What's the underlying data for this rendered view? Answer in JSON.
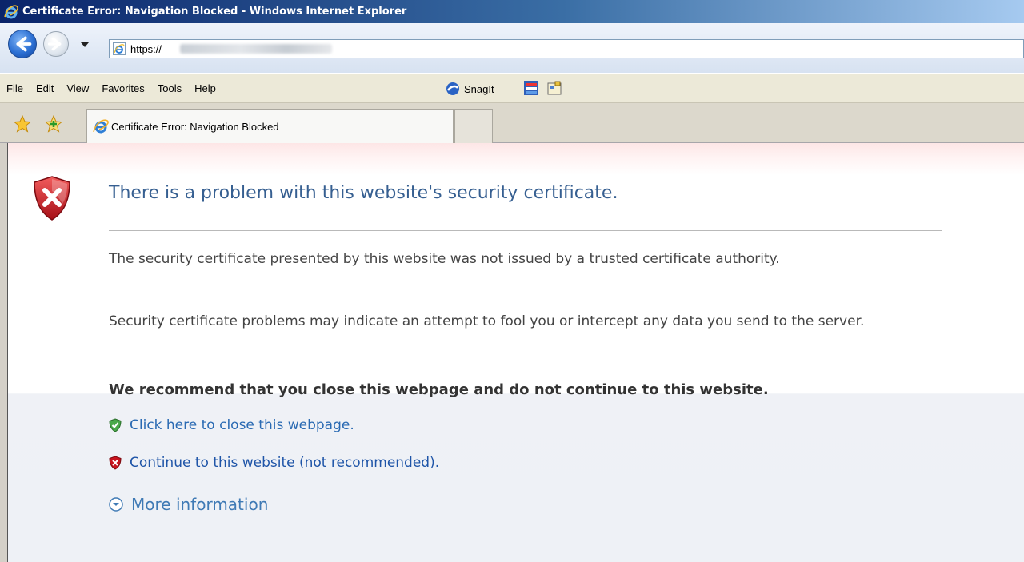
{
  "window": {
    "title": "Certificate Error: Navigation Blocked - Windows Internet Explorer"
  },
  "address_bar": {
    "url": "https://"
  },
  "menu": {
    "items": [
      "File",
      "Edit",
      "View",
      "Favorites",
      "Tools",
      "Help"
    ],
    "snagit_label": "SnagIt"
  },
  "tabs": {
    "active_label": "Certificate Error: Navigation Blocked"
  },
  "page": {
    "heading": "There is a problem with this website's security certificate.",
    "paragraph1": "The security certificate presented by this website was not issued by a trusted certificate authority.",
    "paragraph2": "Security certificate problems may indicate an attempt to fool you or intercept any data you send to the server.",
    "recommendation": "We recommend that you close this webpage and do not continue to this website.",
    "close_link": "Click here to close this webpage.",
    "continue_link": "Continue to this website (not recommended).",
    "more_info": "More information"
  },
  "icons": {
    "title": "ie-icon",
    "back": "back-arrow-icon",
    "forward": "forward-arrow-icon",
    "error": "error-shield-icon",
    "safe": "green-shield-icon",
    "unsafe": "red-shield-icon",
    "expand": "expand-circle-icon"
  },
  "colors": {
    "heading": "#365f91",
    "link": "#2a6ab3",
    "error_red": "#c8141e",
    "safe_green": "#3a9a3a"
  }
}
